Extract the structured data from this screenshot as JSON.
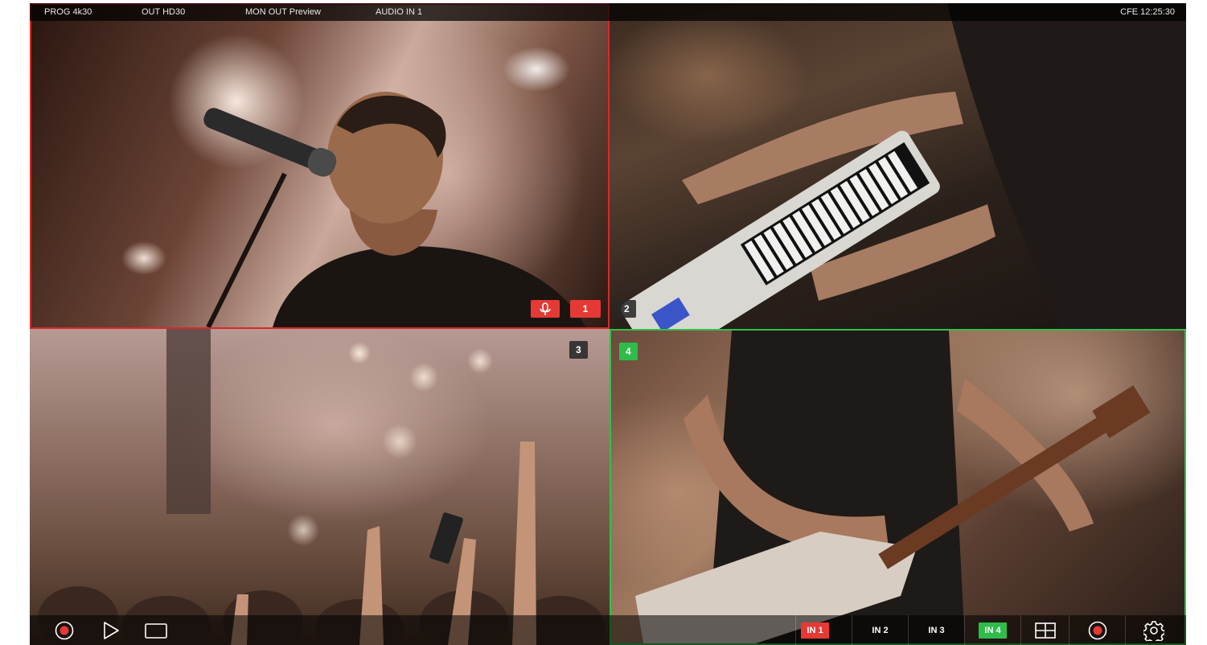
{
  "topbar": {
    "prog": "PROG 4k30",
    "out": "OUT  HD30",
    "mon_out": "MON OUT Preview",
    "audio": "AUDIO IN 1",
    "status": "CFE 12:25:30"
  },
  "cells": {
    "cell1": {
      "tally": "1",
      "mic_icon": "microphone-icon",
      "state": "program",
      "color": "#e53935"
    },
    "cell2": {
      "tally": "2",
      "state": "idle"
    },
    "cell3": {
      "tally": "3",
      "state": "idle"
    },
    "cell4": {
      "tally": "4",
      "state": "preview",
      "color": "#2ebd4a"
    }
  },
  "bottombar": {
    "left_icons": [
      "record-icon",
      "play-icon",
      "screen-icon"
    ],
    "inputs": [
      {
        "label": "IN 1",
        "state": "program"
      },
      {
        "label": "IN 2",
        "state": "idle"
      },
      {
        "label": "IN 3",
        "state": "idle"
      },
      {
        "label": "IN 4",
        "state": "preview"
      }
    ],
    "right_icons": [
      "multiview-grid-icon",
      "record-icon",
      "settings-gear-icon"
    ]
  },
  "colors": {
    "program": "#e53935",
    "preview": "#2ebd4a",
    "record": "#e53935"
  }
}
